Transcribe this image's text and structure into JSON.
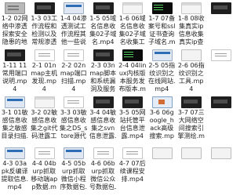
{
  "files": [
    {
      "name": "1-2 02网络中渗透探索安全隐患的地方",
      "thumb": "doc"
    },
    {
      "name": "1-3 03工作流程和检测以及常规渗透测试有何不同",
      "thumb": "dark"
    },
    {
      "name": "1-4 04渗透测试工作流程其他一些说明和建议",
      "thumb": "screen"
    },
    {
      "name": "1-5 05域名信息收集02子域名.mp4",
      "thumb": "dark"
    },
    {
      "name": "1-6 06域名信息收集02子域名收集工具.mp4",
      "thumb": "web"
    },
    {
      "name": "1-7 07备案号和ssl证书查询子域名.mp4",
      "thumb": "terminal"
    },
    {
      "name": "1-8 08收集真实ip信息收集真实ip查看是否有cdn.mp4",
      "thumb": "web"
    },
    {
      "name": "",
      "thumb": "dark"
    },
    {
      "name": "1-11 11常用端口说明.mp4",
      "thumb": "dark"
    },
    {
      "name": "2-1 01nmap主机发现.mp4",
      "thumb": "form"
    },
    {
      "name": "2-2 02nmap端口扫描.mp4",
      "thumb": "form"
    },
    {
      "name": "2-3 03nmap脚本和系统漏洞及服务探测.mp4",
      "thumb": "dark"
    },
    {
      "name": "2-4 04linux内核版本服务发布版本.mp4",
      "thumb": "terminal"
    },
    {
      "name": "2-5 05指纹识别之在线网站.mp4",
      "thumb": "screen"
    },
    {
      "name": "2-6 06指纹识别之工具.mp4",
      "thumb": "blank"
    },
    {
      "name": "",
      "thumb": "form"
    },
    {
      "name": "3-1 01敏感信息收集之敏感目录扫描.mp4",
      "thumb": "screen"
    },
    {
      "name": "3-2 02敏感信息收集之git代码泄露工具.mp4",
      "thumb": "web"
    },
    {
      "name": "3-3 03敏感信息收集之DS_store源代码泄露.mp4",
      "thumb": "form"
    },
    {
      "name": "3-4 04敏感信息收集之svn信息泄露.mp4",
      "thumb": "dark"
    },
    {
      "name": "3-5 05网站托管平台信息泄露.mp4",
      "thumb": "dark"
    },
    {
      "name": "3-6 06google_hack高级搜索.mp4",
      "thumb": "slide"
    },
    {
      "name": "3-7 07三大网络空间搜索引擎测绘.mp4",
      "thumb": "dark"
    },
    {
      "name": "",
      "thumb": "dark"
    },
    {
      "name": "4-3 03apk反编译提取信息.mp4",
      "thumb": "screen"
    },
    {
      "name": "4-4 04burp抓取移动端app数据.mp4",
      "thumb": "form"
    },
    {
      "name": "4-5 05burp抓取微信小程序数据包.mp4",
      "thumb": "screen"
    },
    {
      "name": "4-6 06burp抓取微信公众号数据包.mp4",
      "thumb": "form"
    },
    {
      "name": "4-7 07后续课程安排.mp4",
      "thumb": "form"
    },
    {
      "name": "",
      "thumb": "blank"
    },
    {
      "name": "",
      "thumb": "blank"
    },
    {
      "name": "",
      "thumb": "blank"
    }
  ]
}
